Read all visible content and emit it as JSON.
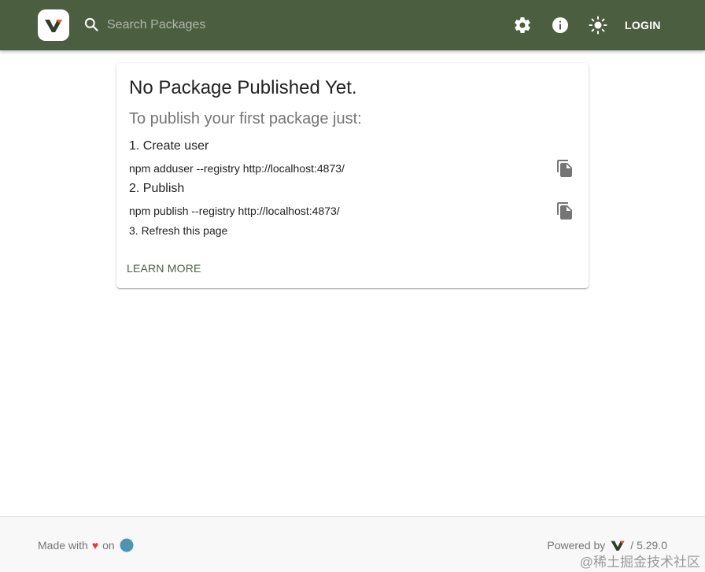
{
  "header": {
    "search_placeholder": "Search Packages",
    "login_label": "LOGIN",
    "brand_color": "#4b5e40"
  },
  "card": {
    "title": "No Package Published Yet.",
    "subtitle": "To publish your first package just:",
    "steps": [
      {
        "label": "1. Create user",
        "command": "npm adduser --registry http://localhost:4873/"
      },
      {
        "label": "2. Publish",
        "command": "npm publish --registry http://localhost:4873/"
      },
      {
        "label": "3. Refresh this page"
      }
    ],
    "learn_more": "LEARN MORE"
  },
  "footer": {
    "made_with": "Made with",
    "heart": "♥",
    "on": "on",
    "powered_by": "Powered by",
    "version": "/ 5.29.0"
  },
  "watermark": "@稀土掘金技术社区"
}
